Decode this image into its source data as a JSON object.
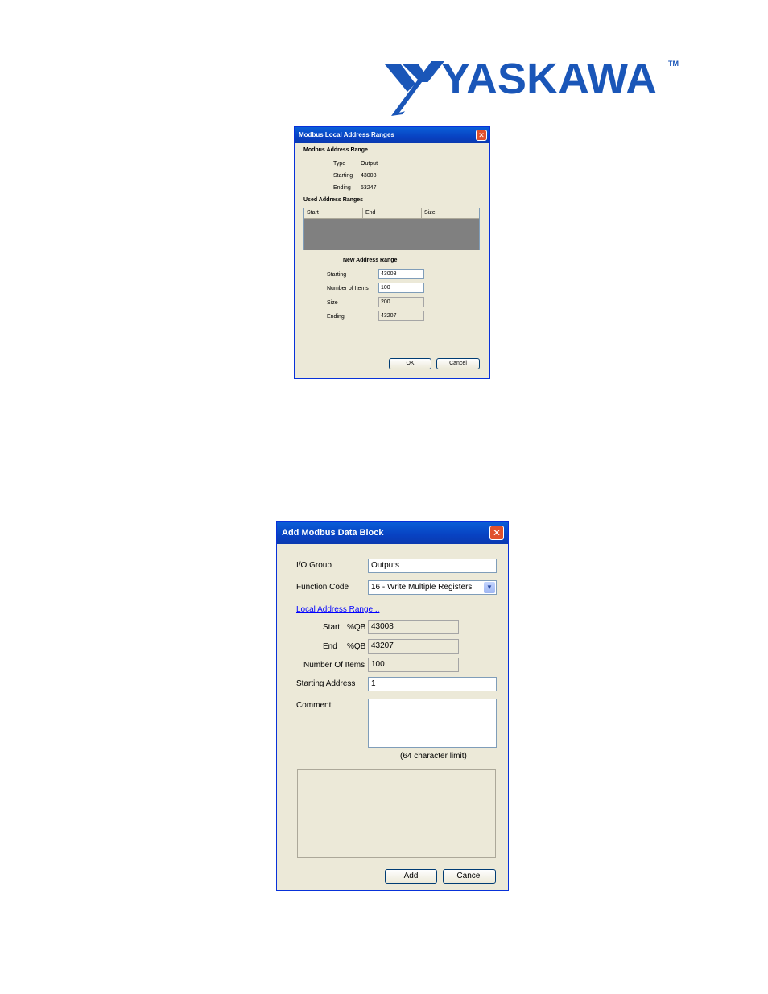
{
  "logo": {
    "text": "YASKAWA",
    "tm": "TM",
    "color": "#1a56b8"
  },
  "dialog1": {
    "title": "Modbus Local Address Ranges",
    "close_glyph": "✕",
    "section_modbus": "Modbus Address Range",
    "type_label": "Type",
    "type_value": "Output",
    "starting_label": "Starting",
    "starting_value": "43008",
    "ending_label": "Ending",
    "ending_value": "53247",
    "section_used": "Used Address Ranges",
    "columns": [
      "Start",
      "End",
      "Size"
    ],
    "section_new": "New Address Range",
    "new_starting_label": "Starting",
    "new_starting_value": "43008",
    "new_items_label": "Number of Items",
    "new_items_value": "100",
    "new_size_label": "Size",
    "new_size_value": "200",
    "new_ending_label": "Ending",
    "new_ending_value": "43207",
    "ok_label": "OK",
    "cancel_label": "Cancel"
  },
  "dialog2": {
    "title": "Add Modbus Data Block",
    "close_glyph": "✕",
    "io_group_label": "I/O Group",
    "io_group_value": "Outputs",
    "function_code_label": "Function Code",
    "function_code_value": "16 - Write Multiple Registers",
    "dropdown_glyph": "▼",
    "local_address_link": "Local Address Range...",
    "start_label": "Start",
    "start_prefix": "%QB",
    "start_value": "43008",
    "end_label": "End",
    "end_prefix": "%QB",
    "end_value": "43207",
    "num_items_label": "Number Of Items",
    "num_items_value": "100",
    "starting_address_label": "Starting Address",
    "starting_address_value": "1",
    "comment_label": "Comment",
    "comment_value": "",
    "comment_hint": "(64 character limit)",
    "add_label": "Add",
    "cancel_label": "Cancel"
  }
}
